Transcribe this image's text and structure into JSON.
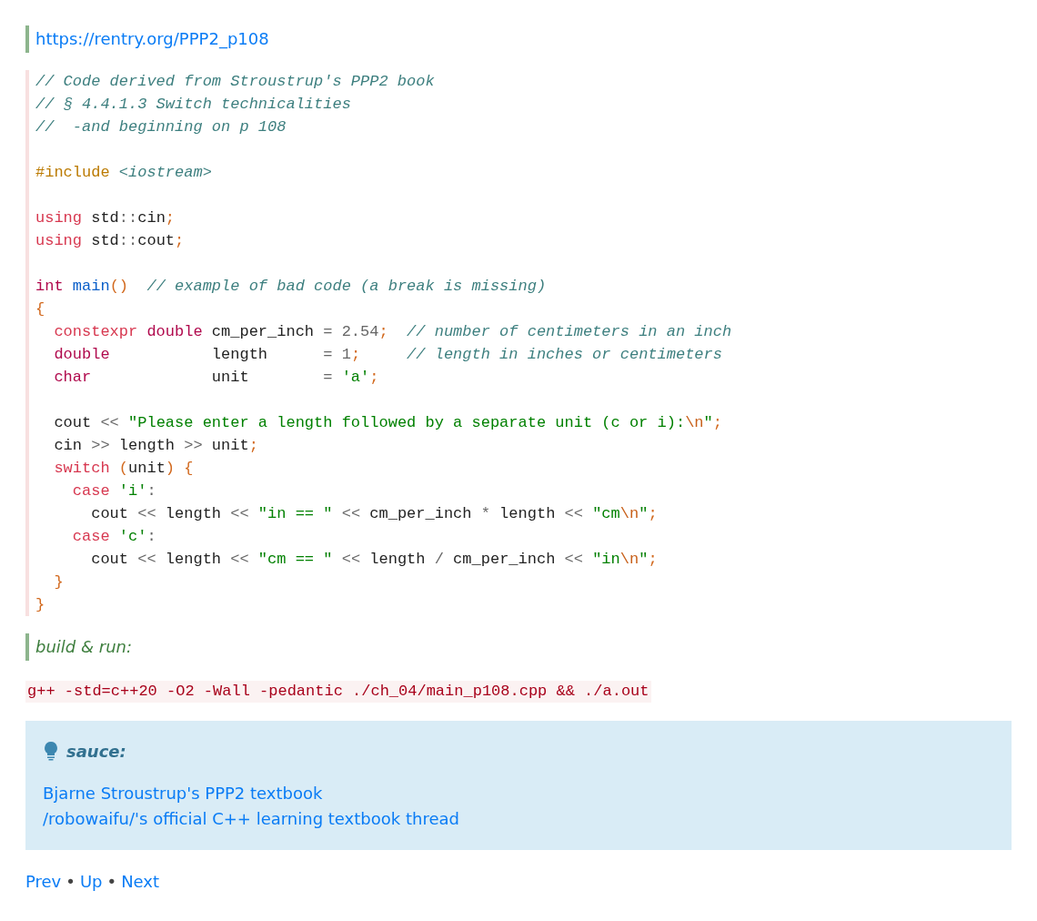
{
  "source_link": "https://rentry.org/PPP2_p108",
  "code": {
    "lines": [
      {
        "kind": "code",
        "tokens": [
          {
            "kind": "comment",
            "text": "// Code derived from Stroustrup's PPP2 book"
          }
        ]
      },
      {
        "kind": "code",
        "tokens": [
          {
            "kind": "comment",
            "text": "// § 4.4.1.3 Switch technicalities"
          }
        ]
      },
      {
        "kind": "code",
        "tokens": [
          {
            "kind": "comment",
            "text": "//  -and beginning on p 108"
          }
        ]
      },
      {
        "kind": "blank"
      },
      {
        "kind": "code",
        "tokens": [
          {
            "kind": "preproc",
            "text": "#include"
          },
          {
            "kind": "include",
            "text": " <iostream>"
          }
        ]
      },
      {
        "kind": "blank"
      },
      {
        "kind": "code",
        "tokens": [
          {
            "kind": "keyword",
            "text": "using"
          },
          {
            "kind": "plain",
            "text": " std"
          },
          {
            "kind": "op",
            "text": "::"
          },
          {
            "kind": "plain",
            "text": "cin"
          },
          {
            "kind": "punct",
            "text": ";"
          }
        ]
      },
      {
        "kind": "code",
        "tokens": [
          {
            "kind": "keyword",
            "text": "using"
          },
          {
            "kind": "plain",
            "text": " std"
          },
          {
            "kind": "op",
            "text": "::"
          },
          {
            "kind": "plain",
            "text": "cout"
          },
          {
            "kind": "punct",
            "text": ";"
          }
        ]
      },
      {
        "kind": "blank"
      },
      {
        "kind": "code",
        "tokens": [
          {
            "kind": "type",
            "text": "int"
          },
          {
            "kind": "func",
            "text": " main"
          },
          {
            "kind": "punct",
            "text": "()"
          },
          {
            "kind": "comment",
            "text": "  // example of bad code (a break is missing)"
          }
        ]
      },
      {
        "kind": "code",
        "tokens": [
          {
            "kind": "punct",
            "text": "{"
          }
        ]
      },
      {
        "kind": "code",
        "tokens": [
          {
            "kind": "keyword",
            "text": "  constexpr"
          },
          {
            "kind": "type",
            "text": " double"
          },
          {
            "kind": "plain",
            "text": " cm_per_inch "
          },
          {
            "kind": "op",
            "text": "="
          },
          {
            "kind": "number",
            "text": " 2.54"
          },
          {
            "kind": "punct",
            "text": ";"
          },
          {
            "kind": "comment",
            "text": "  // number of centimeters in an inch"
          }
        ]
      },
      {
        "kind": "code",
        "tokens": [
          {
            "kind": "type",
            "text": "  double"
          },
          {
            "kind": "plain",
            "text": "           length      "
          },
          {
            "kind": "op",
            "text": "="
          },
          {
            "kind": "number",
            "text": " 1"
          },
          {
            "kind": "punct",
            "text": ";"
          },
          {
            "kind": "comment",
            "text": "     // length in inches or centimeters"
          }
        ]
      },
      {
        "kind": "code",
        "tokens": [
          {
            "kind": "type",
            "text": "  char"
          },
          {
            "kind": "plain",
            "text": "             unit        "
          },
          {
            "kind": "op",
            "text": "="
          },
          {
            "kind": "string",
            "text": " 'a'"
          },
          {
            "kind": "punct",
            "text": ";"
          }
        ]
      },
      {
        "kind": "blank"
      },
      {
        "kind": "code",
        "tokens": [
          {
            "kind": "plain",
            "text": "  cout "
          },
          {
            "kind": "op",
            "text": "<<"
          },
          {
            "kind": "string",
            "text": " \"Please enter a length followed by a separate unit (c or i):"
          },
          {
            "kind": "escape",
            "text": "\\n"
          },
          {
            "kind": "string",
            "text": "\""
          },
          {
            "kind": "punct",
            "text": ";"
          }
        ]
      },
      {
        "kind": "code",
        "tokens": [
          {
            "kind": "plain",
            "text": "  cin "
          },
          {
            "kind": "op",
            "text": ">>"
          },
          {
            "kind": "plain",
            "text": " length "
          },
          {
            "kind": "op",
            "text": ">>"
          },
          {
            "kind": "plain",
            "text": " unit"
          },
          {
            "kind": "punct",
            "text": ";"
          }
        ]
      },
      {
        "kind": "code",
        "tokens": [
          {
            "kind": "keyword",
            "text": "  switch"
          },
          {
            "kind": "punct",
            "text": " ("
          },
          {
            "kind": "plain",
            "text": "unit"
          },
          {
            "kind": "punct",
            "text": ") {"
          }
        ]
      },
      {
        "kind": "code",
        "tokens": [
          {
            "kind": "keyword",
            "text": "    case"
          },
          {
            "kind": "string",
            "text": " 'i'"
          },
          {
            "kind": "op",
            "text": ":"
          }
        ]
      },
      {
        "kind": "code",
        "tokens": [
          {
            "kind": "plain",
            "text": "      cout "
          },
          {
            "kind": "op",
            "text": "<<"
          },
          {
            "kind": "plain",
            "text": " length "
          },
          {
            "kind": "op",
            "text": "<<"
          },
          {
            "kind": "string",
            "text": " \"in == \""
          },
          {
            "kind": "op",
            "text": " <<"
          },
          {
            "kind": "plain",
            "text": " cm_per_inch "
          },
          {
            "kind": "op",
            "text": "*"
          },
          {
            "kind": "plain",
            "text": " length "
          },
          {
            "kind": "op",
            "text": "<<"
          },
          {
            "kind": "string",
            "text": " \"cm"
          },
          {
            "kind": "escape",
            "text": "\\n"
          },
          {
            "kind": "string",
            "text": "\""
          },
          {
            "kind": "punct",
            "text": ";"
          }
        ]
      },
      {
        "kind": "code",
        "tokens": [
          {
            "kind": "keyword",
            "text": "    case"
          },
          {
            "kind": "string",
            "text": " 'c'"
          },
          {
            "kind": "op",
            "text": ":"
          }
        ]
      },
      {
        "kind": "code",
        "tokens": [
          {
            "kind": "plain",
            "text": "      cout "
          },
          {
            "kind": "op",
            "text": "<<"
          },
          {
            "kind": "plain",
            "text": " length "
          },
          {
            "kind": "op",
            "text": "<<"
          },
          {
            "kind": "string",
            "text": " \"cm == \""
          },
          {
            "kind": "op",
            "text": " <<"
          },
          {
            "kind": "plain",
            "text": " length "
          },
          {
            "kind": "op",
            "text": "/"
          },
          {
            "kind": "plain",
            "text": " cm_per_inch "
          },
          {
            "kind": "op",
            "text": "<<"
          },
          {
            "kind": "string",
            "text": " \"in"
          },
          {
            "kind": "escape",
            "text": "\\n"
          },
          {
            "kind": "string",
            "text": "\""
          },
          {
            "kind": "punct",
            "text": ";"
          }
        ]
      },
      {
        "kind": "code",
        "tokens": [
          {
            "kind": "punct",
            "text": "  }"
          }
        ]
      },
      {
        "kind": "code",
        "tokens": [
          {
            "kind": "punct",
            "text": "}"
          }
        ]
      }
    ]
  },
  "build_note": "build & run:",
  "command": "g++ -std=c++20 -O2 -Wall -pedantic ./ch_04/main_p108.cpp && ./a.out",
  "note": {
    "title": "sauce:",
    "links": [
      "Bjarne Stroustrup's PPP2 textbook",
      "/robowaifu/'s official C++ learning textbook thread"
    ]
  },
  "nav": [
    {
      "kind": "link",
      "text": "Prev"
    },
    {
      "kind": "separator",
      "text": "•"
    },
    {
      "kind": "link",
      "text": "Up"
    },
    {
      "kind": "separator",
      "text": "•"
    },
    {
      "kind": "link",
      "text": "Next"
    }
  ]
}
